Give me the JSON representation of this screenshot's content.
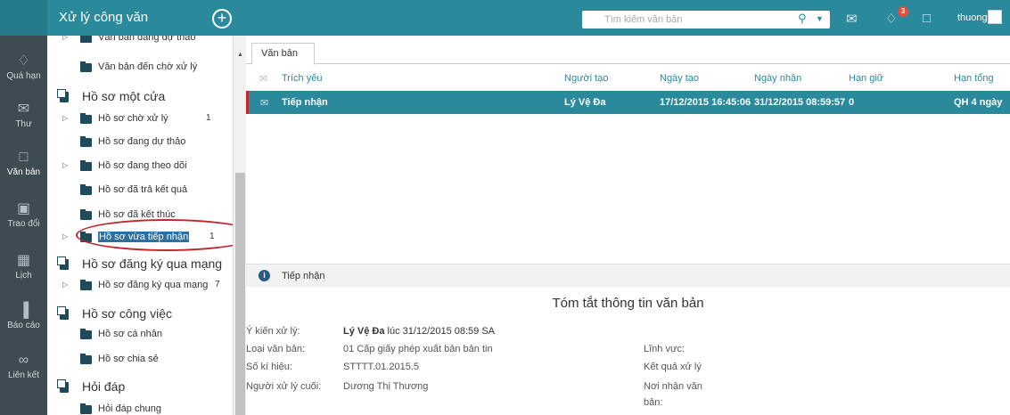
{
  "app": {
    "title": "Xử lý công văn"
  },
  "search": {
    "placeholder": "Tìm kiếm văn bản"
  },
  "user": {
    "name": "thuongdt",
    "notification_count": "3"
  },
  "leftnav": [
    {
      "label": "Quá hạn",
      "icon": "bell-icon"
    },
    {
      "label": "Thư",
      "icon": "mail-icon"
    },
    {
      "label": "Văn bản",
      "icon": "folder-icon"
    },
    {
      "label": "Trao đổi",
      "icon": "chat-icon"
    },
    {
      "label": "Lịch",
      "icon": "calendar-icon"
    },
    {
      "label": "Báo cáo",
      "icon": "chart-icon"
    },
    {
      "label": "Liên kết",
      "icon": "link-icon"
    }
  ],
  "tree": {
    "top_items": [
      {
        "label": "Văn bản đang dự thảo"
      },
      {
        "label": "Văn bản đến chờ xử lý"
      }
    ],
    "groups": [
      {
        "label": "Hồ sơ một cửa",
        "items": [
          {
            "label": "Hồ sơ chờ xử lý",
            "count": "1",
            "expandable": true
          },
          {
            "label": "Hồ sơ đang dự thảo",
            "count": "",
            "expandable": false
          },
          {
            "label": "Hồ sơ đang theo dõi",
            "count": "",
            "expandable": true
          },
          {
            "label": "Hồ sơ đã trả kết quả",
            "count": "",
            "expandable": false
          },
          {
            "label": "Hồ sơ đã kết thúc",
            "count": "",
            "expandable": false
          },
          {
            "label": "Hồ sơ vừa tiếp nhận",
            "count": "1",
            "expandable": true,
            "selected": true
          }
        ]
      },
      {
        "label": "Hồ sơ đăng ký qua mạng",
        "items": [
          {
            "label": "Hồ sơ đăng ký qua mạng",
            "count": "7",
            "expandable": true
          }
        ]
      },
      {
        "label": "Hồ sơ công việc",
        "items": [
          {
            "label": "Hồ sơ cá nhân",
            "count": ""
          },
          {
            "label": "Hồ sơ chia sẻ",
            "count": ""
          }
        ]
      },
      {
        "label": "Hỏi đáp",
        "items": [
          {
            "label": "Hỏi đáp chung",
            "count": ""
          }
        ]
      }
    ]
  },
  "main": {
    "tab": "Văn bản",
    "columns": [
      "Trích yếu",
      "Người tạo",
      "Ngày tạo",
      "Ngày nhận",
      "Hạn giữ",
      "Hạn tổng"
    ],
    "rows": [
      {
        "trich_yeu": "Tiếp nhận",
        "nguoi_tao": "Lý Vệ Đa",
        "ngay_tao": "17/12/2015 16:45:06",
        "ngay_nhan": "31/12/2015 08:59:57",
        "han_giu": "0",
        "han_tong": "QH 4 ngày"
      }
    ]
  },
  "detail": {
    "header": "Tiếp nhận",
    "summary_title": "Tóm tắt thông tin văn bản",
    "y_kien_label": "Ý kiến xử lý:",
    "y_kien_name": "Lý Vệ Đa",
    "y_kien_time": "lúc 31/12/2015 08:59 SA",
    "loai_label": "Loại văn bản:",
    "loai_value": "01 Cấp giấy phép xuất bản bản tin",
    "so_label": "Số kí hiệu:",
    "so_value": "STTTT.01.2015.5",
    "nguoi_label": "Người xử lý cuối:",
    "nguoi_value": "Dương Thị Thương",
    "linh_vuc_label": "Lĩnh vực:",
    "ket_qua_label": "Kết quả xử lý",
    "noi_nhan_label_1": "Nơi nhận văn",
    "noi_nhan_label_2": "bản:"
  }
}
